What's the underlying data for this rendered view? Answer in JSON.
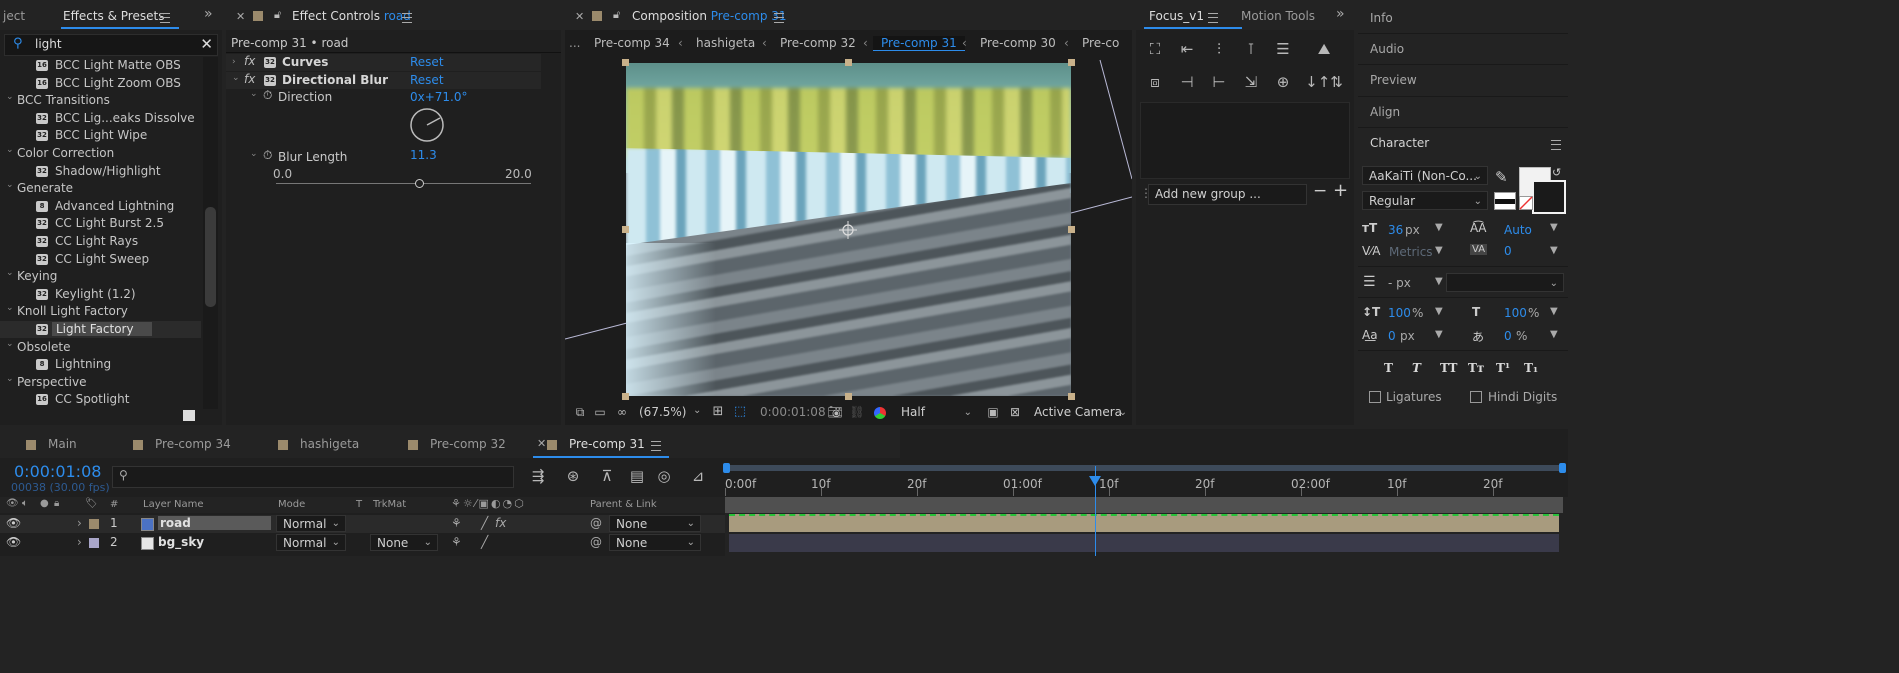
{
  "project_panel": {
    "tab_project": "ject",
    "tab_effects": "Effects & Presets",
    "search_value": "light",
    "tree": [
      {
        "kind": "effect",
        "badge": "16",
        "label": "BCC Light Matte OBS"
      },
      {
        "kind": "effect",
        "badge": "16",
        "label": "BCC Light Zoom OBS"
      },
      {
        "kind": "folder",
        "label": "BCC Transitions"
      },
      {
        "kind": "effect",
        "badge": "32",
        "label": "BCC Lig...eaks Dissolve"
      },
      {
        "kind": "effect",
        "badge": "32",
        "label": "BCC Light Wipe"
      },
      {
        "kind": "folder",
        "label": "Color Correction"
      },
      {
        "kind": "effect",
        "badge": "32",
        "label": "Shadow/Highlight"
      },
      {
        "kind": "folder",
        "label": "Generate"
      },
      {
        "kind": "effect",
        "badge": "8",
        "label": "Advanced Lightning"
      },
      {
        "kind": "effect",
        "badge": "32",
        "label": "CC Light Burst 2.5"
      },
      {
        "kind": "effect",
        "badge": "32",
        "label": "CC Light Rays"
      },
      {
        "kind": "effect",
        "badge": "32",
        "label": "CC Light Sweep"
      },
      {
        "kind": "folder",
        "label": "Keying"
      },
      {
        "kind": "effect",
        "badge": "32",
        "label": "Keylight (1.2)"
      },
      {
        "kind": "folder",
        "label": "Knoll Light Factory"
      },
      {
        "kind": "effect",
        "badge": "32",
        "label": "Light Factory",
        "selected": true
      },
      {
        "kind": "folder",
        "label": "Obsolete"
      },
      {
        "kind": "effect",
        "badge": "8",
        "label": "Lightning"
      },
      {
        "kind": "folder",
        "label": "Perspective"
      },
      {
        "kind": "effect",
        "badge": "16",
        "label": "CC Spotlight"
      }
    ]
  },
  "effect_controls": {
    "tab_title": "Effect Controls",
    "tab_layer": "road",
    "breadcrumb": "Pre-comp 31 • road",
    "effects": [
      {
        "name": "Curves",
        "reset": "Reset"
      },
      {
        "name": "Directional Blur",
        "reset": "Reset"
      }
    ],
    "direction_label": "Direction",
    "direction_value": "0x+71.0°",
    "blur_label": "Blur Length",
    "blur_value": "11.3",
    "slider_min": "0.0",
    "slider_max": "20.0",
    "slider_fraction": 0.565
  },
  "composition": {
    "tab_title": "Composition",
    "tab_comp": "Pre-comp 31",
    "nav_dots": "...",
    "nav_tabs": [
      "Pre-comp 34",
      "hashigeta",
      "Pre-comp 32",
      "Pre-comp 31",
      "Pre-comp 30",
      "Pre-co"
    ],
    "active_nav": "Pre-comp 31",
    "zoom": "(67.5%)",
    "timecode": "0:00:01:08",
    "resolution": "Half",
    "camera": "Active Camera"
  },
  "focus_panel": {
    "tab_focus": "Focus_v1",
    "tab_motion": "Motion Tools",
    "add_group_placeholder": "Add new group ...",
    "minus": "−",
    "plus": "+"
  },
  "right_panel": {
    "info": "Info",
    "audio": "Audio",
    "preview": "Preview",
    "align": "Align",
    "character": "Character",
    "font": "AaKaiTi (Non-Co...",
    "style": "Regular",
    "size": "36",
    "size_unit": "px",
    "leading": "Auto",
    "kerning": "Metrics",
    "tracking": "0",
    "indent": "- px",
    "vscale": "100",
    "hscale": "100",
    "pct": "%",
    "baseline": "0",
    "baseline_unit": "px",
    "tsume": "0",
    "tsume_unit": "%",
    "ligatures": "Ligatures",
    "hindi_digits": "Hindi Digits",
    "type_buttons": [
      "T",
      "T",
      "TT",
      "Tт",
      "T¹",
      "T₁"
    ]
  },
  "timeline": {
    "tabs": [
      {
        "label": "Main",
        "color": "#9b8a6c"
      },
      {
        "label": "Pre-comp 34",
        "color": "#9b8a6c"
      },
      {
        "label": "hashigeta",
        "color": "#9b8a6c"
      },
      {
        "label": "Pre-comp 32",
        "color": "#9b8a6c"
      },
      {
        "label": "Pre-comp 31",
        "color": "#9b8a6c",
        "active": true
      }
    ],
    "timecode": "0:00:01:08",
    "frames": "00038 (30.00 fps)",
    "columns": {
      "hash": "#",
      "layer_name": "Layer Name",
      "mode": "Mode",
      "t": "T",
      "trkmat": "TrkMat",
      "parent": "Parent & Link"
    },
    "ruler": [
      "0:00f",
      "10f",
      "20f",
      "01:00f",
      "10f",
      "20f",
      "02:00f",
      "10f",
      "20f"
    ],
    "playhead_fraction": 0.442,
    "layers": [
      {
        "num": "1",
        "name": "road",
        "mode": "Normal",
        "trkmat": "",
        "parent": "None",
        "color": "#9b8a6c",
        "selected": true
      },
      {
        "num": "2",
        "name": "bg_sky",
        "mode": "Normal",
        "trkmat": "None",
        "parent": "None",
        "color": "#a9a6c9"
      }
    ]
  }
}
